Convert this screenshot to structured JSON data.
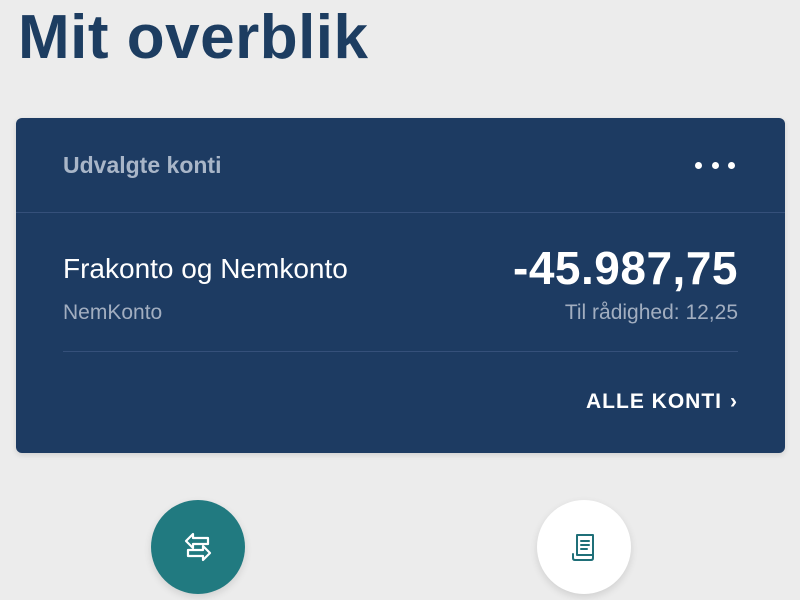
{
  "page": {
    "title": "Mit overblik"
  },
  "card": {
    "title": "Udvalgte konti",
    "menu_icon": "more-horizontal-icon",
    "account": {
      "name": "Frakonto og Nemkonto",
      "type": "NemKonto",
      "balance": "-45.987,75",
      "available": "Til rådighed: 12,25"
    },
    "all_accounts_label": "ALLE KONTI",
    "all_accounts_chevron": "›"
  },
  "actions": [
    {
      "icon": "transfer-arrows-icon",
      "color": "#217a80"
    },
    {
      "icon": "receipt-icon",
      "color": "#ffffff"
    }
  ],
  "colors": {
    "background": "#ececec",
    "card": "#1d3b62",
    "title": "#1d3d61",
    "accent_teal": "#217a80"
  }
}
